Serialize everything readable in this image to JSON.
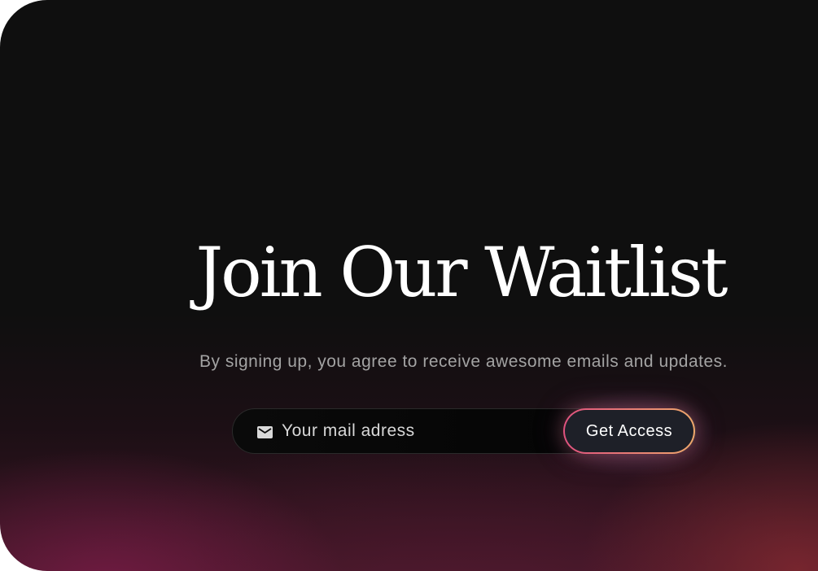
{
  "hero": {
    "title": "Join Our Waitlist",
    "subtitle": "By signing up, you agree to receive awesome emails and updates."
  },
  "signup_form": {
    "email": {
      "placeholder": "Your mail adress",
      "value": "",
      "icon": "mail-icon"
    },
    "submit_label": "Get Access"
  },
  "colors": {
    "background": "#0f0f0f",
    "accent_gradient_start": "#e0527f",
    "accent_gradient_end": "#f0a86c",
    "button_fill": "#1e2028"
  }
}
